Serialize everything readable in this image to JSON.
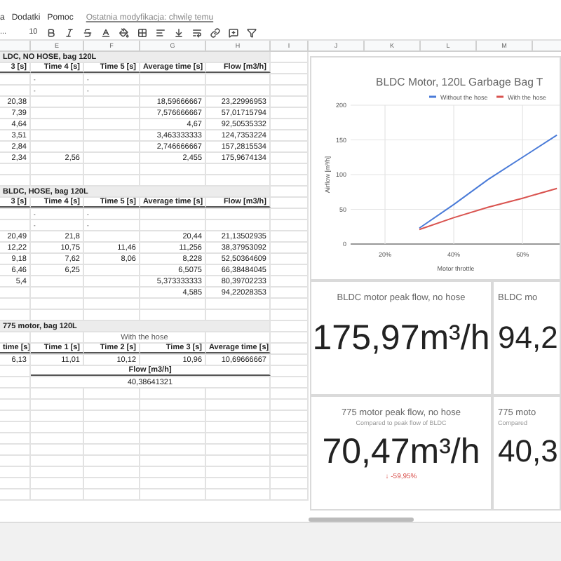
{
  "menu": {
    "items": [
      "a",
      "Dodatki",
      "Pomoc"
    ],
    "last_edit": "Ostatnia modyfikacja: chwilę temu"
  },
  "toolbar": {
    "font": "...",
    "font_size": "10"
  },
  "sheet": {
    "columns": [
      "",
      "E",
      "F",
      "G",
      "H",
      "I"
    ],
    "rows": [
      {
        "kind": "title",
        "cells": [
          "LDC, NO HOSE, bag 120L"
        ]
      },
      {
        "kind": "header",
        "cells": [
          "3 [s]",
          "Time 4 [s]",
          "Time 5 [s]",
          "Average time [s]",
          "Flow [m3/h]"
        ]
      },
      {
        "kind": "dash",
        "cells": [
          "",
          "-",
          "-",
          "",
          ""
        ]
      },
      {
        "kind": "dash",
        "cells": [
          "",
          "-",
          "-",
          "",
          ""
        ]
      },
      {
        "kind": "data",
        "cells": [
          "20,38",
          "",
          "",
          "18,59666667",
          "23,22996953"
        ]
      },
      {
        "kind": "data",
        "cells": [
          "7,39",
          "",
          "",
          "7,576666667",
          "57,01715794"
        ]
      },
      {
        "kind": "data",
        "cells": [
          "4,64",
          "",
          "",
          "4,67",
          "92,50535332"
        ]
      },
      {
        "kind": "data",
        "cells": [
          "3,51",
          "",
          "",
          "3,463333333",
          "124,7353224"
        ]
      },
      {
        "kind": "data",
        "cells": [
          "2,84",
          "",
          "",
          "2,746666667",
          "157,2815534"
        ]
      },
      {
        "kind": "data",
        "cells": [
          "2,34",
          "2,56",
          "",
          "2,455",
          "175,9674134"
        ]
      },
      {
        "kind": "blank",
        "cells": []
      },
      {
        "kind": "blank",
        "cells": []
      },
      {
        "kind": "title",
        "cells": [
          "BLDC, HOSE, bag 120L"
        ]
      },
      {
        "kind": "header",
        "cells": [
          "3 [s]",
          "Time 4 [s]",
          "Time 5 [s]",
          "Average time [s]",
          "Flow [m3/h]"
        ]
      },
      {
        "kind": "dash",
        "cells": [
          "",
          "-",
          "-",
          "",
          ""
        ]
      },
      {
        "kind": "dash",
        "cells": [
          "",
          "-",
          "-",
          "",
          ""
        ]
      },
      {
        "kind": "data",
        "cells": [
          "20,49",
          "21,8",
          "",
          "20,44",
          "21,13502935"
        ]
      },
      {
        "kind": "data",
        "cells": [
          "12,22",
          "10,75",
          "11,46",
          "11,256",
          "38,37953092"
        ]
      },
      {
        "kind": "data",
        "cells": [
          "9,18",
          "7,62",
          "8,06",
          "8,228",
          "52,50364609"
        ]
      },
      {
        "kind": "data",
        "cells": [
          "6,46",
          "6,25",
          "",
          "6,5075",
          "66,38484045"
        ]
      },
      {
        "kind": "data",
        "cells": [
          "5,4",
          "",
          "",
          "5,373333333",
          "80,39702233"
        ]
      },
      {
        "kind": "data",
        "cells": [
          "",
          "",
          "",
          "4,585",
          "94,22028353"
        ]
      },
      {
        "kind": "blank",
        "cells": []
      },
      {
        "kind": "blank",
        "cells": []
      },
      {
        "kind": "title",
        "cells": [
          "775 motor, bag 120L"
        ]
      },
      {
        "kind": "note",
        "cells": [
          "With the hose"
        ]
      },
      {
        "kind": "header",
        "cells": [
          "time [s]",
          "Time 1 [s]",
          "Time 2 [s]",
          "Time 3 [s]",
          "Average time [s]"
        ]
      },
      {
        "kind": "data",
        "cells": [
          "6,13",
          "11,01",
          "10,12",
          "10,96",
          "10,69666667"
        ]
      },
      {
        "kind": "merged_header",
        "cells": [
          "Flow [m3/h]"
        ]
      },
      {
        "kind": "merged",
        "cells": [
          "40,38641321"
        ]
      },
      {
        "kind": "blank",
        "cells": []
      },
      {
        "kind": "blank",
        "cells": []
      },
      {
        "kind": "blank",
        "cells": []
      },
      {
        "kind": "blank",
        "cells": []
      },
      {
        "kind": "blank",
        "cells": []
      },
      {
        "kind": "blank",
        "cells": []
      },
      {
        "kind": "blank",
        "cells": []
      },
      {
        "kind": "blank",
        "cells": []
      },
      {
        "kind": "blank",
        "cells": []
      },
      {
        "kind": "blank",
        "cells": []
      }
    ]
  },
  "right_columns": [
    "J",
    "K",
    "L",
    "M"
  ],
  "chart": {
    "chart_data": {
      "type": "line",
      "title": "BLDC Motor, 120L Garbage Bag T",
      "xlabel": "Motor throttle",
      "ylabel": "Airflow [m³/h]",
      "x": [
        0.3,
        0.4,
        0.5,
        0.6,
        0.7
      ],
      "series": [
        {
          "name": "Without the hose",
          "color": "#4a7bd8",
          "values": [
            23,
            57,
            93,
            125,
            157
          ]
        },
        {
          "name": "With the hose",
          "color": "#d9534f",
          "values": [
            21,
            38,
            53,
            66,
            80
          ]
        }
      ],
      "grid": true,
      "legend": true,
      "xlim": [
        0.1,
        0.72
      ],
      "ylim": [
        0,
        200
      ],
      "yticks": [
        0,
        50,
        100,
        150,
        200
      ],
      "xticks": [
        {
          "value": 0.2,
          "label": "20%"
        },
        {
          "value": 0.4,
          "label": "40%"
        },
        {
          "value": 0.6,
          "label": "60%"
        }
      ]
    }
  },
  "scorecards": [
    {
      "title": "BLDC motor peak flow, no hose",
      "value": "175,97m³/h"
    },
    {
      "title": "BLDC mo",
      "value": "94,2"
    },
    {
      "title": "775 motor peak flow, no hose",
      "subtitle": "Compared to peak flow of BLDC",
      "value": "70,47m³/h",
      "delta": "↓ -59,95%"
    },
    {
      "title": "775 moto",
      "subtitle": "Compared",
      "value": "40,3"
    }
  ]
}
